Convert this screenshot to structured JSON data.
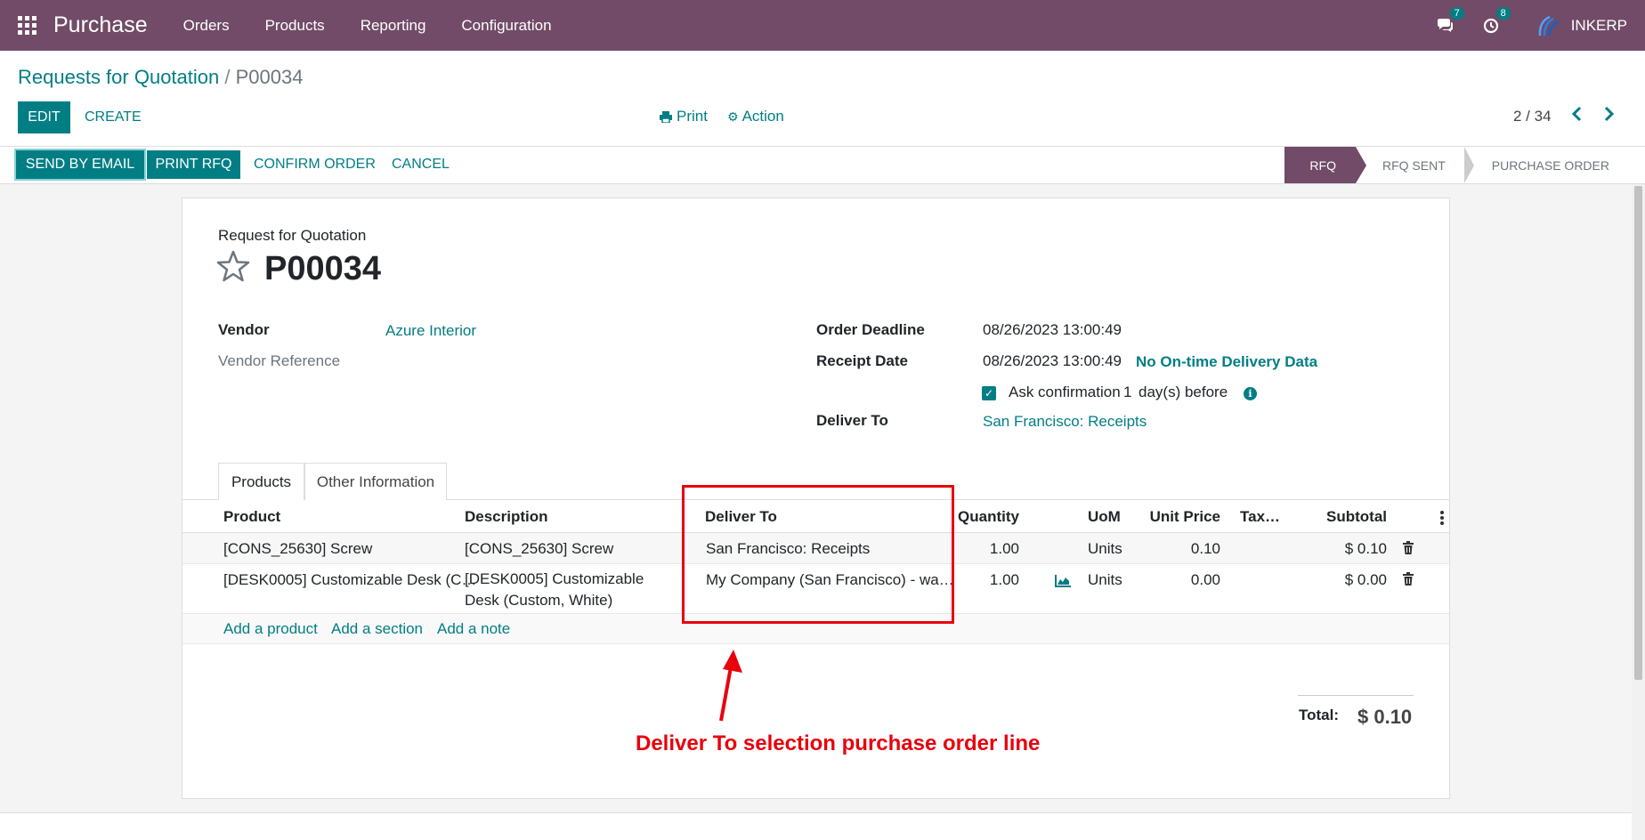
{
  "navbar": {
    "app_name": "Purchase",
    "menu": [
      "Orders",
      "Products",
      "Reporting",
      "Configuration"
    ],
    "messages_badge": "7",
    "activities_badge": "8",
    "company": "INKERP"
  },
  "breadcrumb": {
    "parent": "Requests for Quotation",
    "separator": "/",
    "current": "P00034"
  },
  "toolbar": {
    "edit": "EDIT",
    "create": "CREATE",
    "print": "Print",
    "action": "Action",
    "pager": "2 / 34"
  },
  "statusbar": {
    "send_email": "SEND BY EMAIL",
    "print_rfq": "PRINT RFQ",
    "confirm_order": "CONFIRM ORDER",
    "cancel": "CANCEL",
    "stages": [
      "RFQ",
      "RFQ SENT",
      "PURCHASE ORDER"
    ],
    "active_stage": "RFQ"
  },
  "form": {
    "doc_type": "Request for Quotation",
    "name": "P00034",
    "vendor_label": "Vendor",
    "vendor_value": "Azure Interior",
    "vendor_ref_label": "Vendor Reference",
    "order_deadline_label": "Order Deadline",
    "order_deadline_value": "08/26/2023 13:00:49",
    "receipt_date_label": "Receipt Date",
    "receipt_date_value": "08/26/2023 13:00:49",
    "ontime_link": "No On-time Delivery Data",
    "ask_confirmation": "Ask confirmation",
    "ask_days": "1",
    "ask_suffix": "day(s) before",
    "deliver_to_label": "Deliver To",
    "deliver_to_value": "San Francisco: Receipts"
  },
  "tabs": [
    "Products",
    "Other Information"
  ],
  "order_lines": {
    "columns": [
      "Product",
      "Description",
      "Deliver To",
      "Quantity",
      "UoM",
      "Unit Price",
      "Tax…",
      "Subtotal"
    ],
    "rows": [
      {
        "product": "[CONS_25630] Screw",
        "description": "[CONS_25630] Screw",
        "deliver_to": "San Francisco: Receipts",
        "quantity": "1.00",
        "uom": "Units",
        "unit_price": "0.10",
        "taxes": "",
        "subtotal": "$ 0.10"
      },
      {
        "product": "[DESK0005] Customizable Desk (C…",
        "description": "[DESK0005] Customizable Desk (Custom, White)",
        "deliver_to": "My Company (San Francisco) - wa…",
        "quantity": "1.00",
        "uom": "Units",
        "unit_price": "0.00",
        "taxes": "",
        "subtotal": "$ 0.00"
      }
    ],
    "add_product": "Add a product",
    "add_section": "Add a section",
    "add_note": "Add a note"
  },
  "totals": {
    "label": "Total:",
    "value": "$ 0.10"
  },
  "annotation": {
    "text": "Deliver To selection purchase order line",
    "color": "#e8000d"
  },
  "colors": {
    "brand": "#714b67",
    "accent": "#017e84"
  }
}
